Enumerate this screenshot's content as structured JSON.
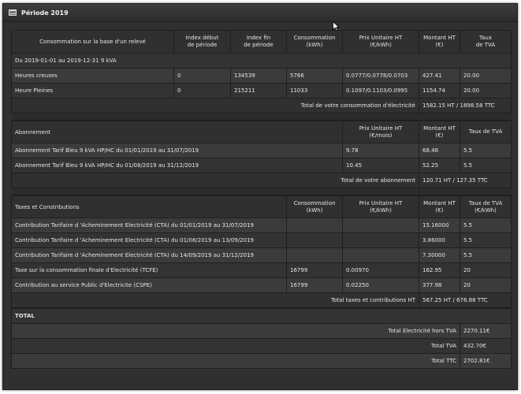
{
  "panel": {
    "title": "Période 2019"
  },
  "consumption": {
    "headers": [
      "Consommation sur la base d'un relevé",
      "Index début de période",
      "Index fin de période",
      "Consommation (kWh)",
      "Prix Unitaire HT (€/kWh)",
      "Montant HT (€)",
      "Taux de TVA"
    ],
    "header_lines": [
      [
        "Consommation sur la base d'un relevé"
      ],
      [
        "Index début",
        "de période"
      ],
      [
        "Index fin",
        "de période"
      ],
      [
        "Consommation",
        "(kWh)"
      ],
      [
        "Prix Unitaire HT",
        "(€/kWh)"
      ],
      [
        "Montant HT",
        "(€)"
      ],
      [
        "Taux",
        "de TVA"
      ]
    ],
    "period_label": "Du 2019-01-01 au 2019-12-31 9 kVA",
    "rows": [
      [
        "Heures creuses",
        "0",
        "134539",
        "5766",
        "0.0777/0.0778/0.0703",
        "427.41",
        "20.00"
      ],
      [
        "Heure Pleines",
        "0",
        "215211",
        "11033",
        "0.1097/0.1103/0.0995",
        "1154.74",
        "20.00"
      ]
    ],
    "total_label": "Total de votre consommation d'électricité",
    "total_value": "1582.15 HT / 1898.58 TTC"
  },
  "subscription": {
    "title": "Abonnement",
    "header_lines": [
      [
        "Prix Unitaire HT",
        "(€/mois)"
      ],
      [
        "Montant HT",
        "(€)"
      ],
      [
        "Taux de TVA"
      ]
    ],
    "rows": [
      [
        "Abonnement Tarif Bleu 9 kVA HP/HC du 01/01/2019 au 31/07/2019",
        "9.78",
        "68.46",
        "5.5"
      ],
      [
        "Abonnement Tarif Bleu 9 kVA HP/HC du 01/08/2019 au 31/12/2019",
        "10.45",
        "52.25",
        "5.5"
      ]
    ],
    "total_label": "Total de votre abonnement",
    "total_value": "120.71 HT / 127.35 TTC"
  },
  "taxes": {
    "title": "Taxes et Constributions",
    "header_lines": [
      [
        "Consommation",
        "(kWh)"
      ],
      [
        "Prix Unitaire HT",
        "(€/kWh)"
      ],
      [
        "Montant HT",
        "(€)"
      ],
      [
        "Taux de TVA",
        "(€/kWh)"
      ]
    ],
    "rows": [
      [
        "Contribution Tarifaire d 'Acheminement Electricité (CTA) du 01/01/2019 au 31/07/2019",
        "",
        "",
        "15.16000",
        "5.5"
      ],
      [
        "Contribution Tarifaire d 'Acheminement Electricité (CTA) du 01/08/2019 au 13/09/2019",
        "",
        "",
        "3.86000",
        "5.5"
      ],
      [
        "Contribution Tarifaire d 'Acheminement Electricité (CTA) du 14/09/2019 au 31/12/2019",
        "",
        "",
        "7.30000",
        "5.5"
      ],
      [
        "Taxe sur la consommation finale d'Electricité (TCFE)",
        "16799",
        "0.00970",
        "162.95",
        "20"
      ],
      [
        "Contribution au service Public d'Electricite (CSPE)",
        "16799",
        "0.02250",
        "377.98",
        "20"
      ]
    ],
    "total_label": "Total taxes et contributions HT",
    "total_value": "567.25 HT / 676.88 TTC"
  },
  "total": {
    "title": "TOTAL",
    "rows": [
      [
        "Total Electricité hors TVA",
        "2270.11€"
      ],
      [
        "Total TVA",
        "432.70€"
      ],
      [
        "Total TTC",
        "2702.81€"
      ]
    ]
  }
}
